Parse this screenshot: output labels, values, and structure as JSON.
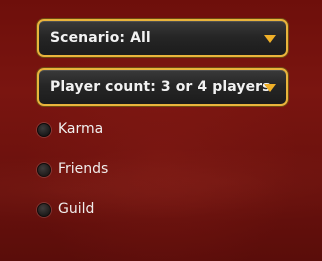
{
  "filters": {
    "scenario_dropdown": {
      "label": "Scenario: All",
      "icon": "chevron-down-icon"
    },
    "player_count_dropdown": {
      "label": "Player count: 3 or 4 players",
      "icon": "chevron-down-icon"
    }
  },
  "options": [
    {
      "label": "Karma",
      "selected": false
    },
    {
      "label": "Friends",
      "selected": false
    },
    {
      "label": "Guild",
      "selected": false
    }
  ],
  "colors": {
    "accent_border": "#e9b43c",
    "arrow": "#f0b028",
    "background": "#6e0f0b"
  }
}
